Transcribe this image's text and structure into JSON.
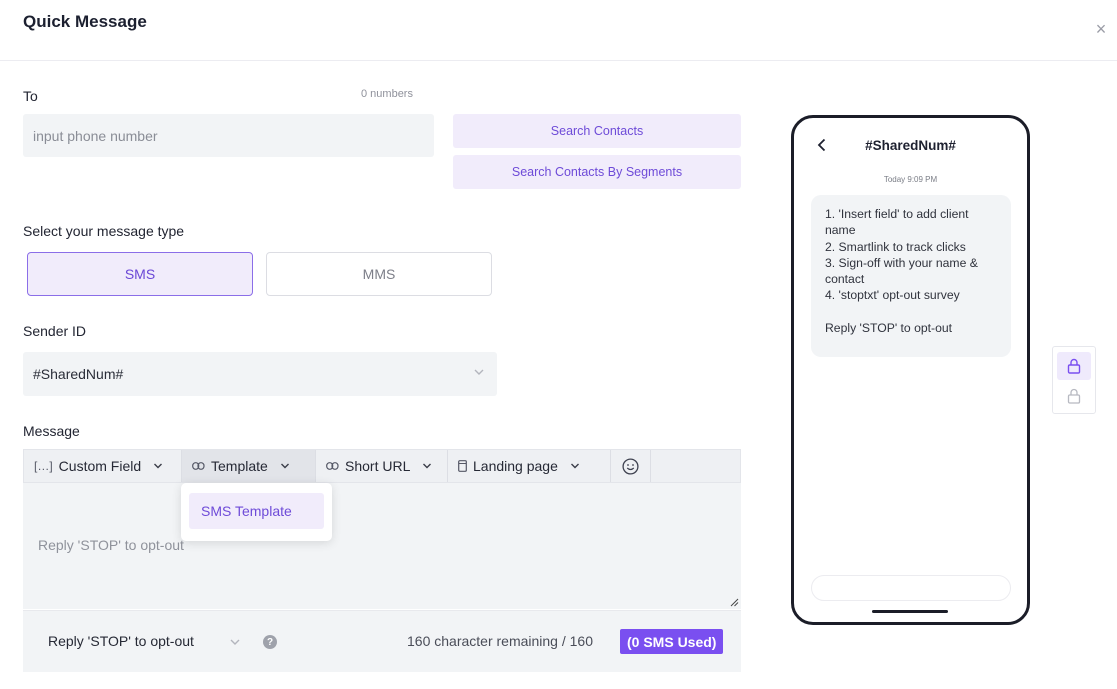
{
  "dialog": {
    "title": "Quick Message",
    "close_glyph": "×"
  },
  "to": {
    "label": "To",
    "count": "0 numbers",
    "placeholder": "input phone number",
    "value": "",
    "search_contacts": "Search Contacts",
    "search_segments": "Search Contacts By Segments"
  },
  "message_type": {
    "label": "Select your message type",
    "options": [
      "SMS",
      "MMS"
    ],
    "selected": "SMS"
  },
  "sender": {
    "label": "Sender ID",
    "value": "#SharedNum#"
  },
  "message": {
    "label": "Message",
    "toolbar": {
      "custom_field": "Custom Field",
      "custom_field_icon": "[…]",
      "template": "Template",
      "short_url": "Short URL",
      "landing_page": "Landing page"
    },
    "template_menu": [
      "SMS Template"
    ],
    "body": "Reply 'STOP' to opt-out"
  },
  "footer": {
    "optout_value": "Reply 'STOP' to opt-out",
    "help_glyph": "?",
    "remaining": "160 character remaining / 160",
    "used": "(0 SMS Used)"
  },
  "preview": {
    "sender": "#SharedNum#",
    "timestamp": "Today 9:09 PM",
    "bubble_text": "1. 'Insert field' to add client name\n2. Smartlink to track clicks\n3. Sign-off with your name & contact\n4. 'stoptxt' opt-out survey\n\nReply 'STOP' to opt-out"
  },
  "colors": {
    "accent": "#7a4ff0",
    "accent_light": "#f1ecfb",
    "field_bg": "#f2f4f6"
  }
}
